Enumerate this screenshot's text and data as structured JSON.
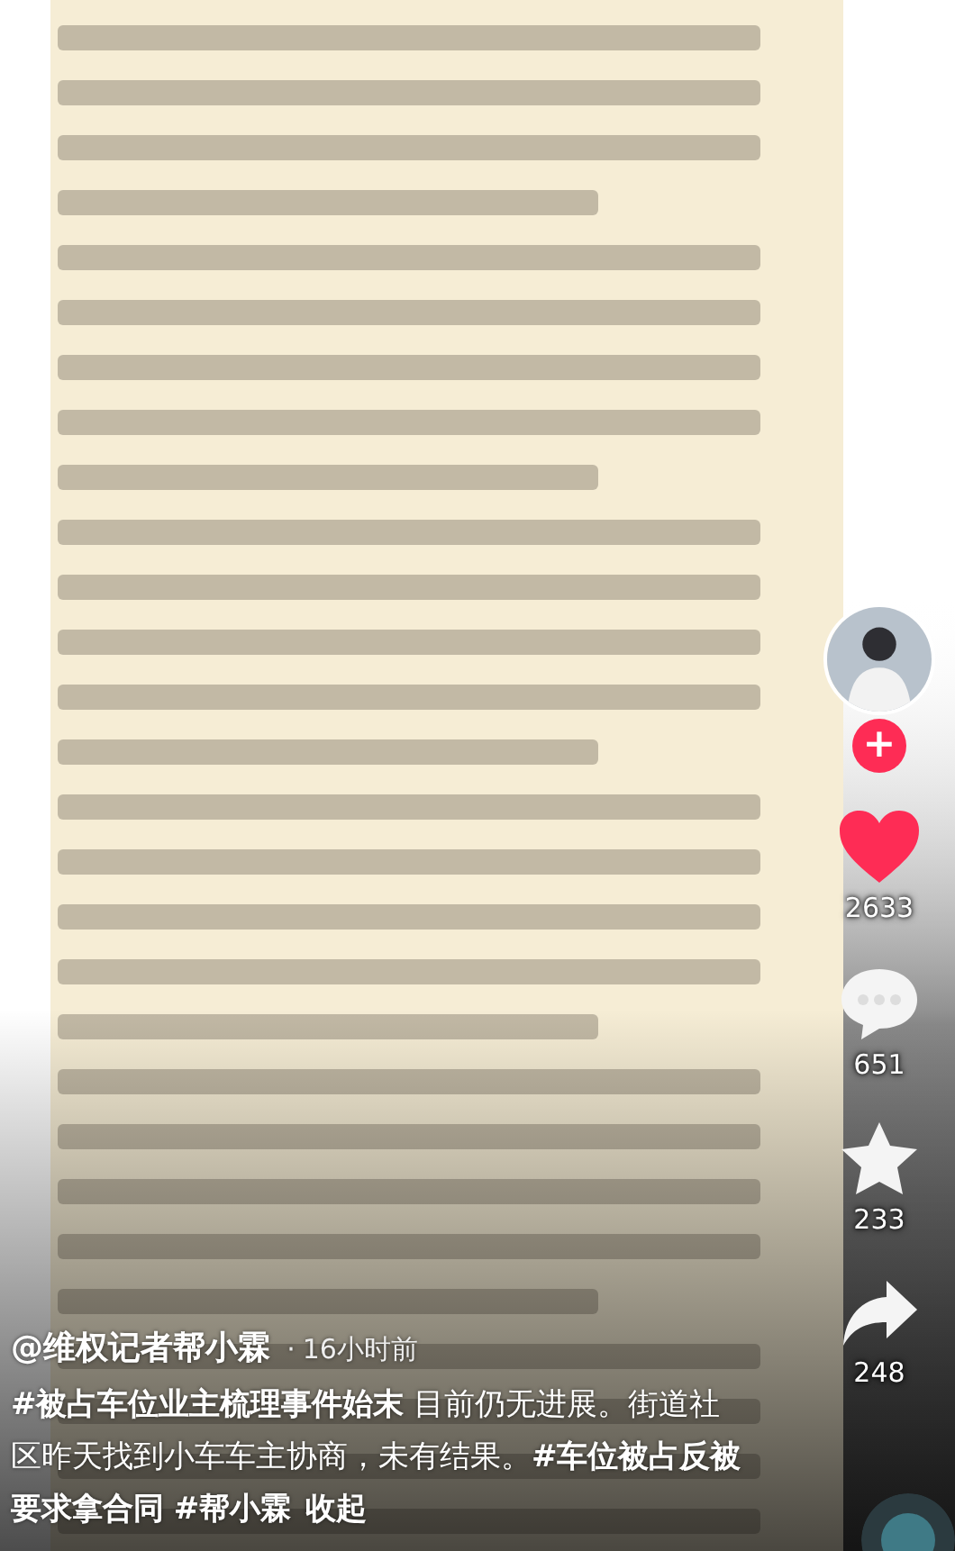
{
  "creator": {
    "follow_button": "+"
  },
  "actions": [
    {
      "kind": "like",
      "count": "2633",
      "selected": true
    },
    {
      "kind": "comment",
      "count": "651"
    },
    {
      "kind": "favorite",
      "count": "233",
      "selected": false
    },
    {
      "kind": "share",
      "count": "248"
    }
  ],
  "caption": {
    "author": "@维权记者帮小霖",
    "separator": "·",
    "time": "16小时前",
    "description": "**#被占车位业主梳理事件始末** 目前仍无进展。街道社区昨天找到小车车主协商，未有结果。**#车位被占反被要求拿合同** **#帮小霖**",
    "collapse_link": "收起"
  }
}
